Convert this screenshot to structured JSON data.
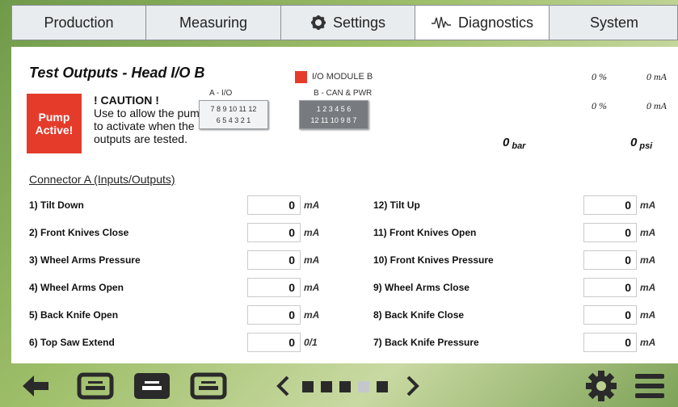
{
  "tabs": [
    {
      "label": "Production",
      "icon": ""
    },
    {
      "label": "Measuring",
      "icon": ""
    },
    {
      "label": "Settings",
      "icon": "gear-icon"
    },
    {
      "label": "Diagnostics",
      "icon": "waveform-icon"
    },
    {
      "label": "System",
      "icon": ""
    }
  ],
  "page": {
    "title": "Test Outputs - Head I/O B",
    "pump_button": "Pump Active!",
    "caution_heading": "! CAUTION !",
    "caution_lines": [
      "Use to allow the pumps",
      "to activate when the",
      "outputs are tested."
    ],
    "module_label": "I/O MODULE B",
    "module_color": "#e53b2b",
    "group_a_label": "A - I/O",
    "group_b_label": "B - CAN & PWR",
    "group_a_rows": [
      "7 8 9 10 11 12",
      "6 5 4 3 2 1"
    ],
    "group_b_rows": [
      "1 2 3 4 5 6",
      "12 11 10 9 8 7"
    ],
    "readouts": {
      "r1_pct": "0 %",
      "r1_ma": "0 mA",
      "r2_pct": "0 %",
      "r2_ma": "0 mA",
      "bar_val": "0",
      "bar_unit": "bar",
      "psi_val": "0",
      "psi_unit": "psi"
    },
    "connector_header": "Connector A (Inputs/Outputs)"
  },
  "left_rows": [
    {
      "label": "1) Tilt Down",
      "value": "0",
      "unit": "mA"
    },
    {
      "label": "2) Front Knives Close",
      "value": "0",
      "unit": "mA"
    },
    {
      "label": "3) Wheel Arms Pressure",
      "value": "0",
      "unit": "mA"
    },
    {
      "label": "4) Wheel Arms Open",
      "value": "0",
      "unit": "mA"
    },
    {
      "label": "5) Back Knife Open",
      "value": "0",
      "unit": "mA"
    },
    {
      "label": "6) Top Saw Extend",
      "value": "0",
      "unit": "0/1"
    }
  ],
  "right_rows": [
    {
      "label": "12) Tilt Up",
      "value": "0",
      "unit": "mA"
    },
    {
      "label": "11) Front Knives Open",
      "value": "0",
      "unit": "mA"
    },
    {
      "label": "10) Front Knives Pressure",
      "value": "0",
      "unit": "mA"
    },
    {
      "label": "9) Wheel Arms Close",
      "value": "0",
      "unit": "mA"
    },
    {
      "label": "8) Back Knife Close",
      "value": "0",
      "unit": "mA"
    },
    {
      "label": "7) Back Knife Pressure",
      "value": "0",
      "unit": "mA"
    }
  ],
  "bottom": {
    "icons": [
      "back-arrow-icon",
      "panel-1-icon",
      "panel-2-icon",
      "panel-3-icon",
      "chevron-left-icon",
      "chevron-right-icon",
      "gear-icon",
      "hamburger-menu-icon"
    ],
    "page_dots_total": 5,
    "page_dot_active": 4
  }
}
